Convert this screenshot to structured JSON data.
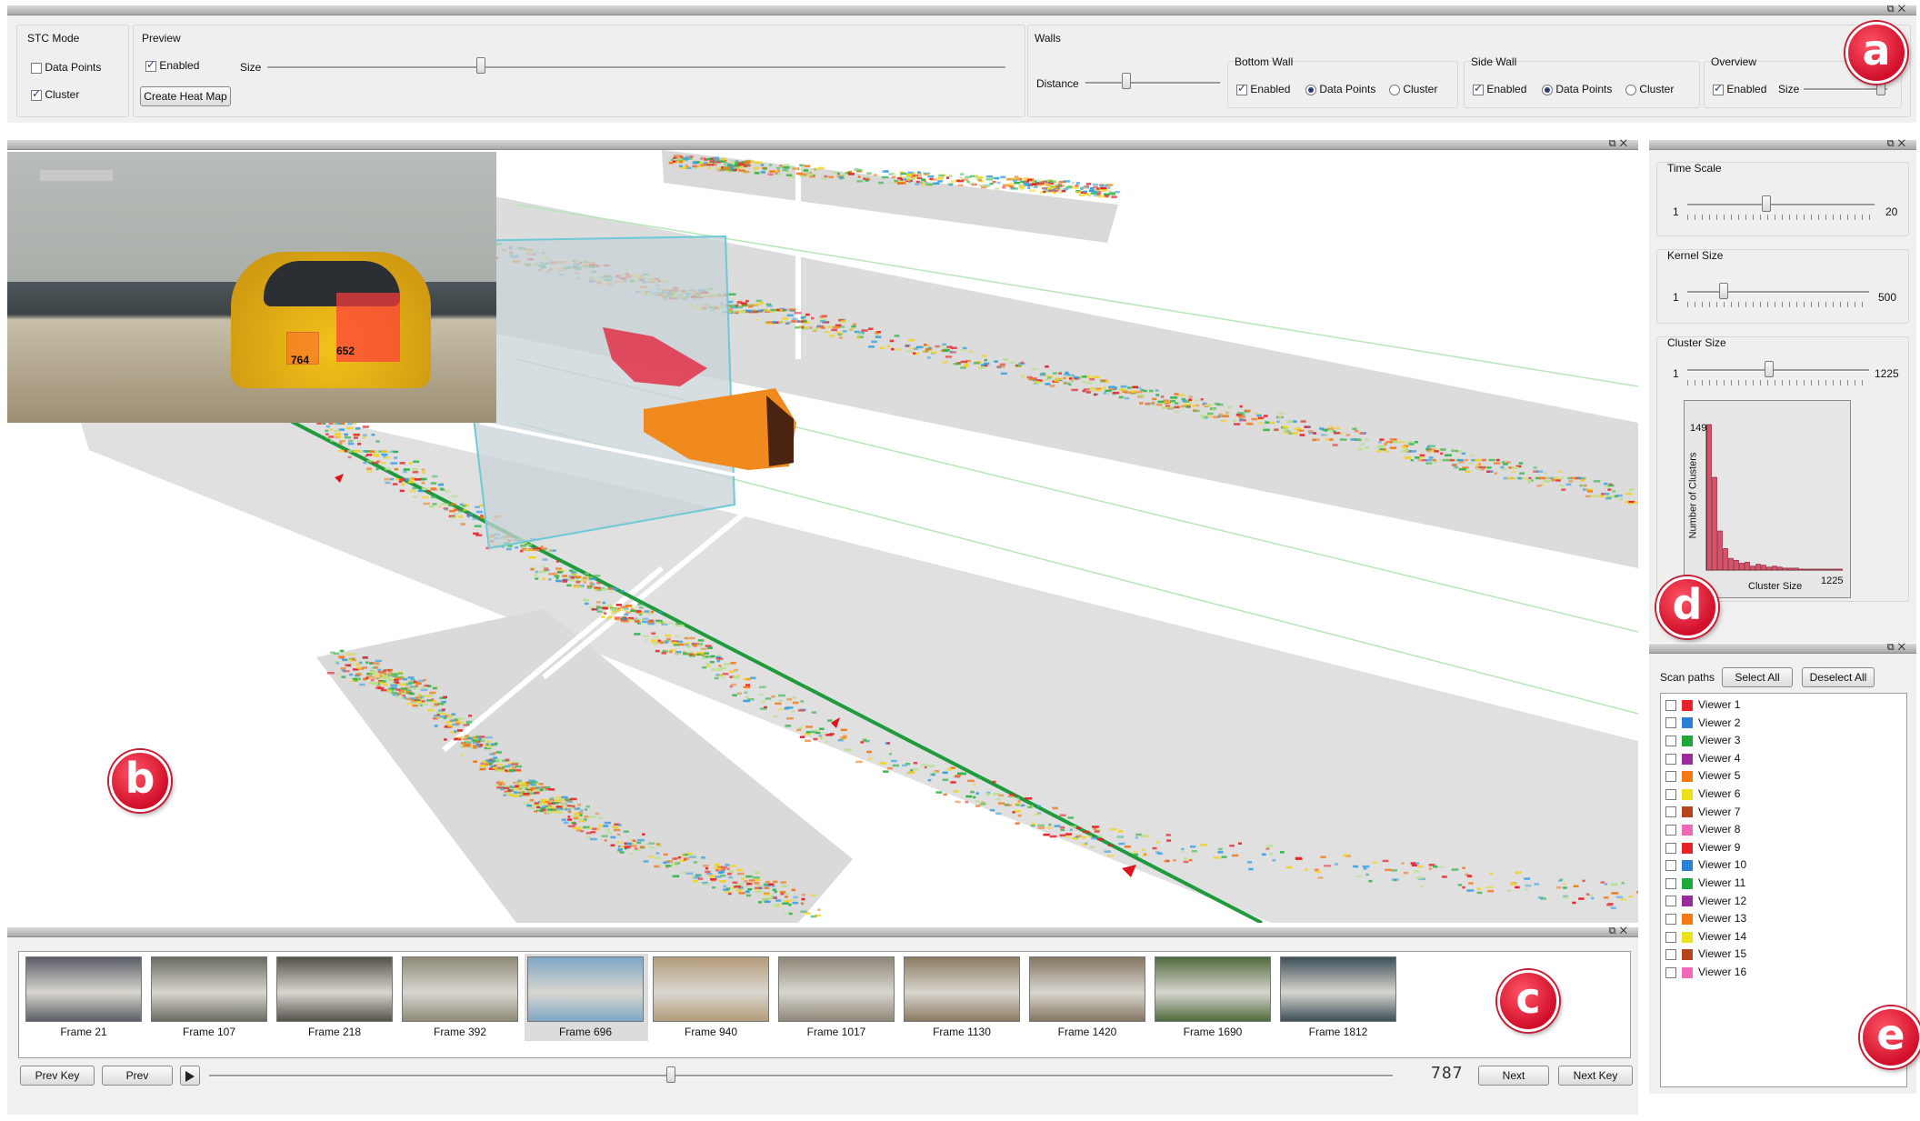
{
  "top_panel": {
    "stc_mode": {
      "title": "STC Mode",
      "data_points": {
        "label": "Data Points",
        "checked": false
      },
      "cluster": {
        "label": "Cluster",
        "checked": true
      }
    },
    "preview": {
      "title": "Preview",
      "enabled": {
        "label": "Enabled",
        "checked": true
      },
      "size_label": "Size",
      "size_value": 0.3,
      "create_heat_map": "Create Heat Map"
    },
    "walls": {
      "title": "Walls",
      "distance_label": "Distance",
      "distance_value": 0.3,
      "bottom_wall": {
        "title": "Bottom Wall",
        "enabled": "Enabled",
        "data_points": "Data Points",
        "cluster": "Cluster"
      },
      "side_wall": {
        "title": "Side Wall",
        "enabled": "Enabled",
        "data_points": "Data Points",
        "cluster": "Cluster"
      },
      "overview": {
        "title": "Overview",
        "enabled": "Enabled",
        "size_label": "Size",
        "size_value": 0.95
      }
    }
  },
  "right_panel": {
    "time_scale": {
      "title": "Time Scale",
      "min": "1",
      "max": "20",
      "value_fraction": 0.42
    },
    "kernel_size": {
      "title": "Kernel Size",
      "min": "1",
      "max": "500",
      "value_fraction": 0.2
    },
    "cluster_size": {
      "title": "Cluster Size",
      "min": "1",
      "max": "1225",
      "value_fraction": 0.45
    },
    "histogram": {
      "y_top_label": "149",
      "y_axis_label": "Number of Clusters",
      "x_axis_label": "Cluster Size",
      "x_max_label": "1225"
    }
  },
  "chart_data": {
    "type": "bar",
    "xlabel": "Cluster Size",
    "ylabel": "Number of Clusters",
    "ylim": [
      0,
      149
    ],
    "xlim": [
      1,
      1225
    ],
    "values": [
      149,
      95,
      40,
      22,
      12,
      10,
      7,
      8,
      4,
      6,
      5,
      3,
      4,
      3,
      2,
      2,
      2,
      1,
      1,
      1,
      1,
      1,
      1,
      1,
      1
    ]
  },
  "scan_paths": {
    "title": "Scan paths",
    "select_all": "Select All",
    "deselect_all": "Deselect All",
    "viewers": [
      {
        "label": "Viewer 1",
        "color": "#e8202a"
      },
      {
        "label": "Viewer 2",
        "color": "#2a7fd6"
      },
      {
        "label": "Viewer 3",
        "color": "#1fa83a"
      },
      {
        "label": "Viewer 4",
        "color": "#9c2a9c"
      },
      {
        "label": "Viewer 5",
        "color": "#f57a12"
      },
      {
        "label": "Viewer 6",
        "color": "#ece01a"
      },
      {
        "label": "Viewer 7",
        "color": "#b5451b"
      },
      {
        "label": "Viewer 8",
        "color": "#f068b8"
      },
      {
        "label": "Viewer 9",
        "color": "#e8202a"
      },
      {
        "label": "Viewer 10",
        "color": "#2a7fd6"
      },
      {
        "label": "Viewer 11",
        "color": "#1fa83a"
      },
      {
        "label": "Viewer 12",
        "color": "#9c2a9c"
      },
      {
        "label": "Viewer 13",
        "color": "#f57a12"
      },
      {
        "label": "Viewer 14",
        "color": "#ece01a"
      },
      {
        "label": "Viewer 15",
        "color": "#b5451b"
      },
      {
        "label": "Viewer 16",
        "color": "#f068b8"
      }
    ]
  },
  "video_preview": {
    "label_left": "764",
    "label_right": "652"
  },
  "filmstrip": {
    "frames": [
      {
        "label": "Frame 21",
        "tint": "#5a5e66"
      },
      {
        "label": "Frame 107",
        "tint": "#6b6b62"
      },
      {
        "label": "Frame 218",
        "tint": "#55524c"
      },
      {
        "label": "Frame 392",
        "tint": "#8e8a78"
      },
      {
        "label": "Frame 696",
        "tint": "#7fa7c6"
      },
      {
        "label": "Frame 940",
        "tint": "#b49c7a"
      },
      {
        "label": "Frame 1017",
        "tint": "#8f8778"
      },
      {
        "label": "Frame 1130",
        "tint": "#8c7a62"
      },
      {
        "label": "Frame 1420",
        "tint": "#857663"
      },
      {
        "label": "Frame 1690",
        "tint": "#4f6a3c"
      },
      {
        "label": "Frame 1812",
        "tint": "#3c4f58"
      }
    ],
    "selected_index": 4,
    "prev_key": "Prev Key",
    "prev": "Prev",
    "next": "Next",
    "next_key": "Next Key",
    "frame_counter": "787",
    "position_fraction": 0.39
  },
  "badges": {
    "a": "a",
    "b": "b",
    "c": "c",
    "d": "d",
    "e": "e"
  }
}
